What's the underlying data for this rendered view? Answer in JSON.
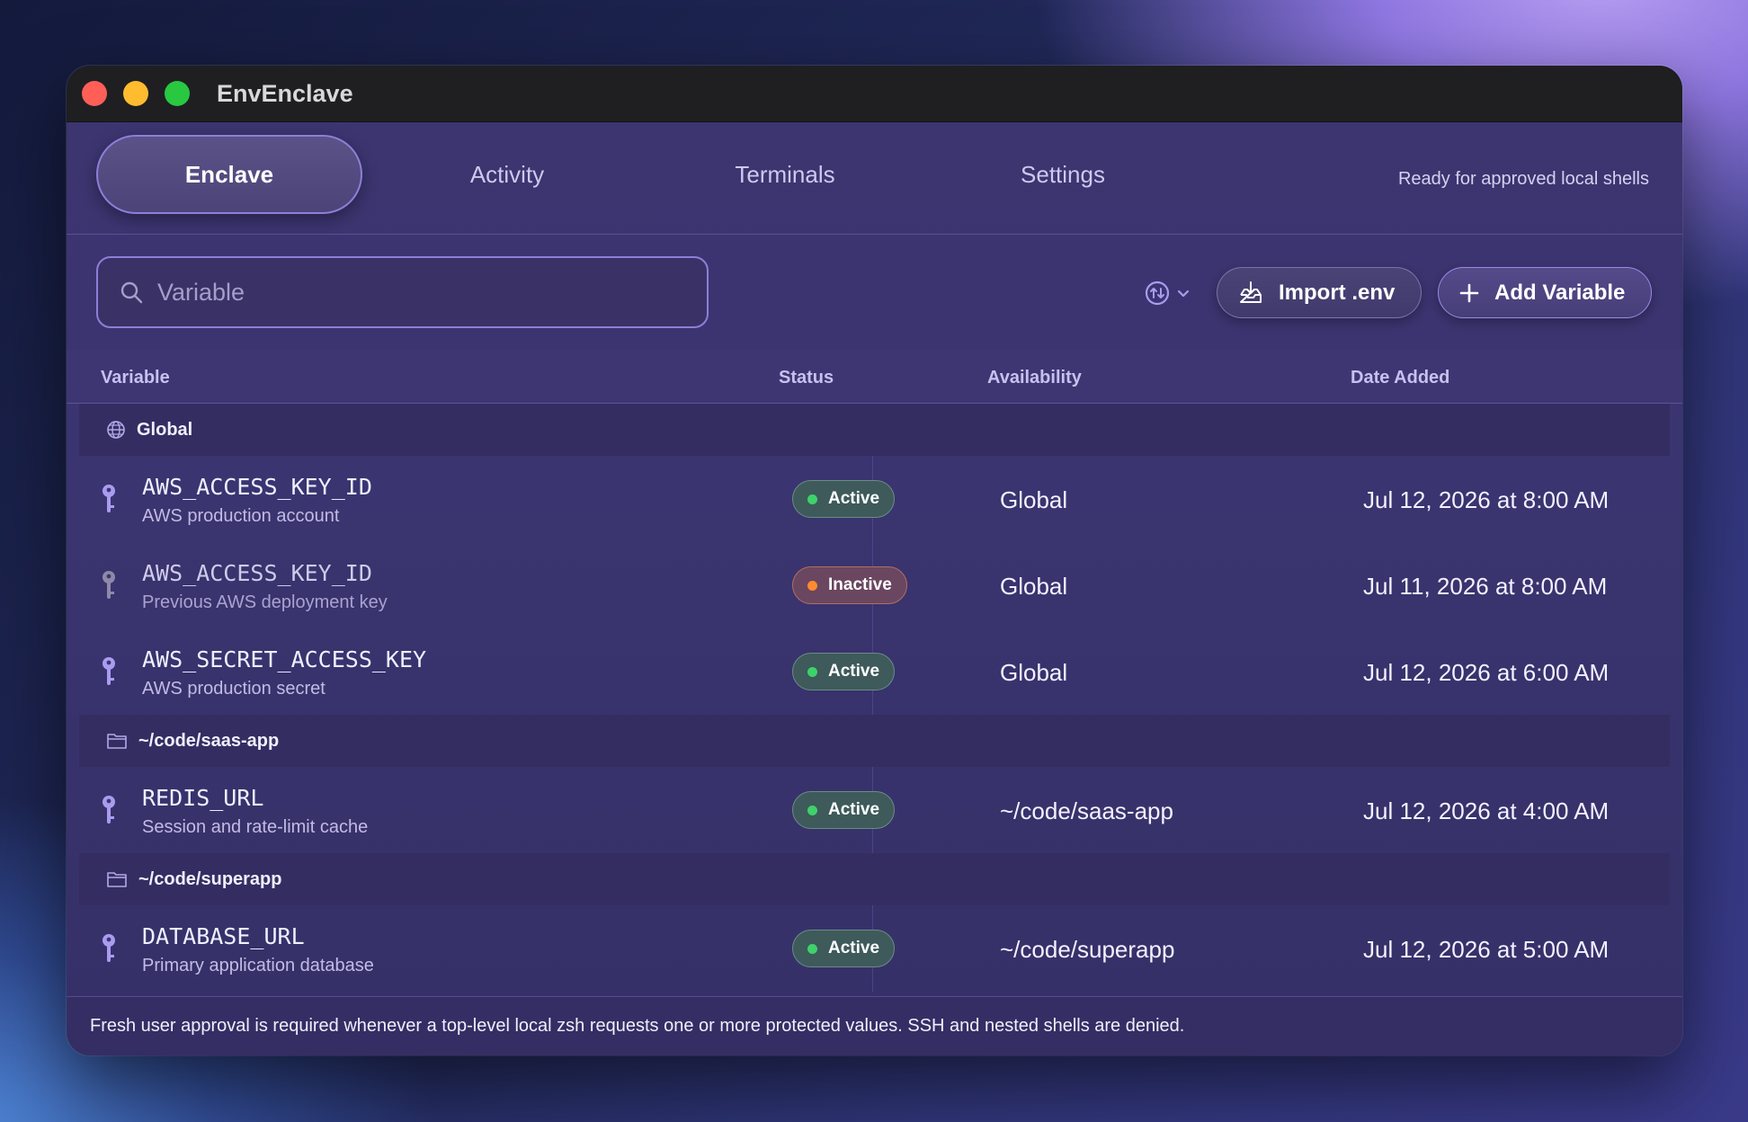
{
  "window": {
    "title": "EnvEnclave"
  },
  "tabs": [
    {
      "label": "Enclave",
      "active": true
    },
    {
      "label": "Activity",
      "active": false
    },
    {
      "label": "Terminals",
      "active": false
    },
    {
      "label": "Settings",
      "active": false
    }
  ],
  "status_text": "Ready for approved local shells",
  "search": {
    "placeholder": "Variable",
    "value": ""
  },
  "toolbar": {
    "import_label": "Import .env",
    "add_label": "Add Variable",
    "sort_icon": "sort-icon"
  },
  "table": {
    "headers": {
      "variable": "Variable",
      "status": "Status",
      "availability": "Availability",
      "date_added": "Date Added"
    },
    "groups": [
      {
        "label": "Global",
        "icon": "globe-icon",
        "rows": [
          {
            "name": "AWS_ACCESS_KEY_ID",
            "description": "AWS production account",
            "status": "Active",
            "availability": "Global",
            "date": "Jul 12, 2026 at 8:00 AM"
          },
          {
            "name": "AWS_ACCESS_KEY_ID",
            "description": "Previous AWS deployment key",
            "status": "Inactive",
            "availability": "Global",
            "date": "Jul 11, 2026 at 8:00 AM"
          },
          {
            "name": "AWS_SECRET_ACCESS_KEY",
            "description": "AWS production secret",
            "status": "Active",
            "availability": "Global",
            "date": "Jul 12, 2026 at 6:00 AM"
          }
        ]
      },
      {
        "label": "~/code/saas-app",
        "icon": "folder-icon",
        "rows": [
          {
            "name": "REDIS_URL",
            "description": "Session and rate-limit cache",
            "status": "Active",
            "availability": "~/code/saas-app",
            "date": "Jul 12, 2026 at 4:00 AM"
          }
        ]
      },
      {
        "label": "~/code/superapp",
        "icon": "folder-icon",
        "rows": [
          {
            "name": "DATABASE_URL",
            "description": "Primary application database",
            "status": "Active",
            "availability": "~/code/superapp",
            "date": "Jul 12, 2026 at 5:00 AM"
          }
        ]
      }
    ]
  },
  "footer_text": "Fresh user approval is required whenever a top-level local zsh requests one or more protected values. SSH and nested shells are denied.",
  "colors": {
    "accent": "#8d7fd8",
    "active": "#3dd26a",
    "inactive": "#ff8a30",
    "key_active": "#a99cf0",
    "key_inactive": "#8e89a8"
  }
}
